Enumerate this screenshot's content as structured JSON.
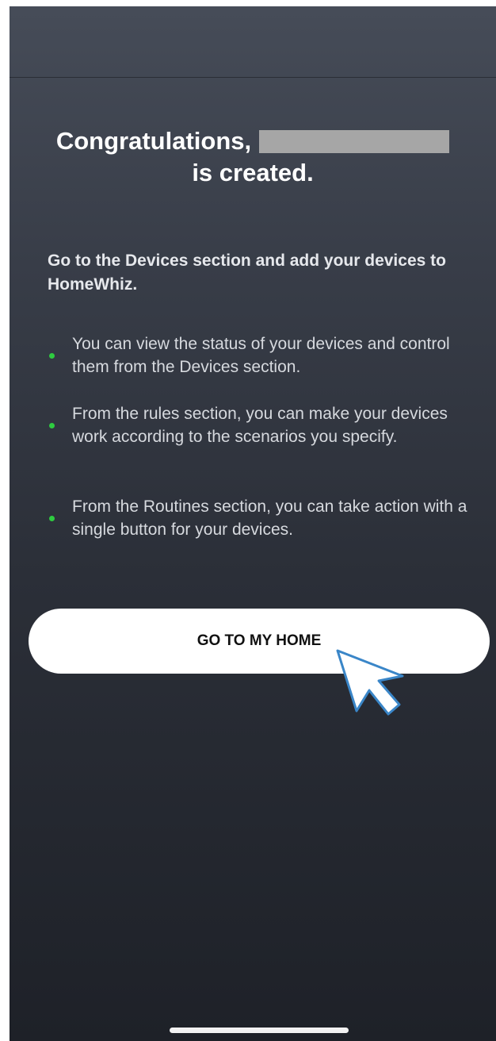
{
  "congrats": {
    "prefix": "Congratulations,",
    "suffix": "is created."
  },
  "intro": "Go to the Devices section and add your devices to HomeWhiz.",
  "bullets": [
    "You can view the status of your devices and control them from the Devices section.",
    "From the rules section, you can make your devices work according to the scenarios you specify.",
    "From the Routines section, you can take action with a single button for your devices."
  ],
  "primary_button": {
    "label": "GO TO MY HOME"
  },
  "colors": {
    "bullet": "#2ecc40",
    "redacted": "#a6a6a6",
    "cursor_outline": "#3a86c8"
  },
  "icons": {
    "cursor": "pointer-cursor-icon",
    "bullet": "bullet-dot-icon"
  }
}
